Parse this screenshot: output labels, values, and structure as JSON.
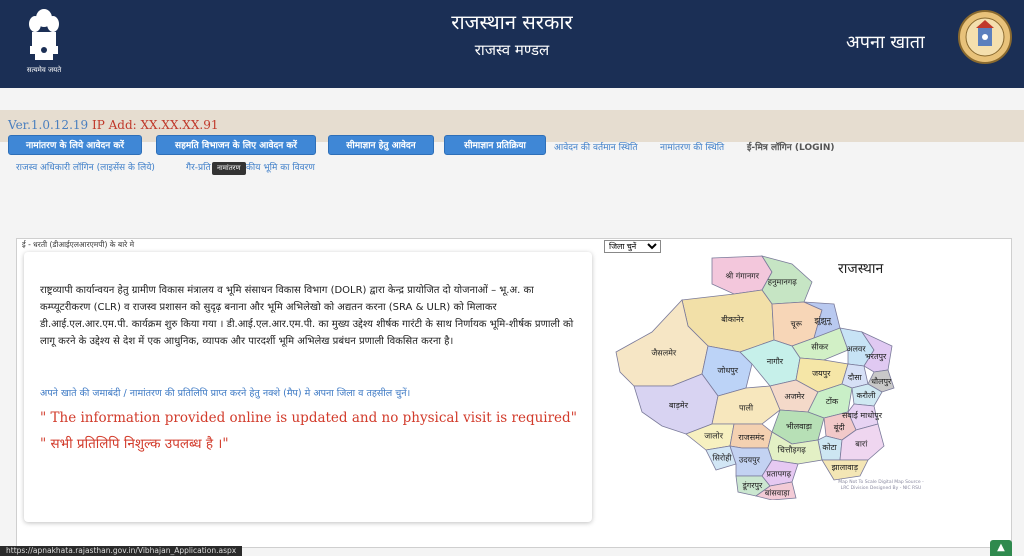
{
  "header": {
    "emblem_caption": "सत्यमेव जयते",
    "title": "राजस्थान सरकार",
    "subtitle": "राजस्व मण्डल",
    "right_title": "अपना खाता",
    "colors": {
      "header_bg": "#1b2f55",
      "nav_button": "#3f87d6",
      "link": "#3f7fc9",
      "notice_red": "#d23b2b"
    }
  },
  "version": {
    "label": "Ver.1.0.12.19",
    "ip": "IP Add: XX.XX.XX.91"
  },
  "nav": {
    "buttons": [
      "नामांतरण के लिये आवेदन करें",
      "सहमति विभाजन के लिए आवेदन करें",
      "सीमाज्ञान हेतु आवेदन",
      "सीमाज्ञान प्रतिक्रिया"
    ],
    "links": [
      "आवेदन की वर्तमान स्थिति",
      "नामांतरण की स्थिति",
      "ई-मित्र लॉगिन (LOGIN)",
      "राजस्व अधिकारी लॉगिन (लाइसेंस के लिये)",
      "गैर-प्रति",
      "कीय भूमि का विवरण"
    ],
    "tooltip": "नामांतरण"
  },
  "panel": {
    "heading": "ई - धरती (डीआईएलआरएमपी) के बारे मे",
    "paragraph": "राष्ट्रव्यापी कार्यान्वयन हेतु ग्रामीण विकास मंत्रालय व भूमि संसाधन विकास विभाग (DOLR) द्वारा केन्द्र प्रायोजित दो योजनाओं – भू.अ. का कम्प्यूटरीकरण (CLR) व राजस्व प्रशासन को सुदृढ़ बनाना और भूमि अभिलेखो को अद्यतन करना (SRA & ULR) को मिलाकर डी.आई.एल.आर.एम.पी. कार्यक्रम शुरु किया गया । डी.आई.एल.आर.एम.पी. का मुख्य उद्देश्य शीर्षक गारंटी के साथ निर्णायक भूमि-शीर्षक प्रणाली को लागू करने के उद्देश्य से देश में एक आधुनिक, व्यापक और पारदर्शी भूमि अभिलेख प्रबंधन प्रणाली विकसित करना है।",
    "instruction": "अपने खाते की जमाबंदी / नामांतरण की प्रतिलिपि प्राप्त करने हेतु नक्शे (मैप) मे अपना जिला व तहसील चुनें।",
    "notice_en": "\" The information provided online is updated and no physical visit is required\"",
    "notice_hi": "\" सभी प्रतिलिपि निशुल्क उपलब्ध है ।\""
  },
  "map": {
    "select_label": "जिला चुनें",
    "title": "राजस्थान",
    "credit": "Map Not To Scale Digital Map Source - LRC Division Designed By - NIC RSU",
    "districts": [
      {
        "name": "श्री गंगानगर",
        "color": "#f3c7dc"
      },
      {
        "name": "हनुमानगढ़",
        "color": "#c6e5c4"
      },
      {
        "name": "बीकानेर",
        "color": "#f2e0a8"
      },
      {
        "name": "चूरू",
        "color": "#f7d6b7"
      },
      {
        "name": "झुंझुनू",
        "color": "#b9c9f0"
      },
      {
        "name": "सीकर",
        "color": "#d2f0c6"
      },
      {
        "name": "अलवर",
        "color": "#c7e3f5"
      },
      {
        "name": "भरतपुर",
        "color": "#e0c9f2"
      },
      {
        "name": "धौलपुर",
        "color": "#c8c8c8"
      },
      {
        "name": "जैसलमेर",
        "color": "#f6e6c5"
      },
      {
        "name": "जोधपुर",
        "color": "#bcd3f7"
      },
      {
        "name": "नागौर",
        "color": "#c6f0ea"
      },
      {
        "name": "जयपुर",
        "color": "#f5e6a7"
      },
      {
        "name": "दौसा",
        "color": "#d6e0f6"
      },
      {
        "name": "करौली",
        "color": "#cfe9f2"
      },
      {
        "name": "अजमेर",
        "color": "#f4d9c9"
      },
      {
        "name": "टोंक",
        "color": "#c9efc7"
      },
      {
        "name": "सवाई माधोपुर",
        "color": "#e7d3f3"
      },
      {
        "name": "बाड़मेर",
        "color": "#d8d3f2"
      },
      {
        "name": "पाली",
        "color": "#f7e7bd"
      },
      {
        "name": "भीलवाड़ा",
        "color": "#b7e0b6"
      },
      {
        "name": "बूंदी",
        "color": "#f2c9c9"
      },
      {
        "name": "कोटा",
        "color": "#cde6f2"
      },
      {
        "name": "बारां",
        "color": "#efd6f0"
      },
      {
        "name": "जालोर",
        "color": "#f7f0c0"
      },
      {
        "name": "सिरोही",
        "color": "#d2e6f5"
      },
      {
        "name": "राजसमंद",
        "color": "#f4d1b1"
      },
      {
        "name": "चित्तौड़गढ़",
        "color": "#e3f0c5"
      },
      {
        "name": "झालावाड़",
        "color": "#f4e6b5"
      },
      {
        "name": "उदयपुर",
        "color": "#c3d2f2"
      },
      {
        "name": "प्रतापगढ़",
        "color": "#e6c9f2"
      },
      {
        "name": "डूंगरपुर",
        "color": "#cbe7d0"
      },
      {
        "name": "बांसवाड़ा",
        "color": "#f3cbd6"
      }
    ]
  },
  "status_bar": {
    "url": "https://apnakhata.rajasthan.gov.in/Vibhajan_Application.aspx"
  },
  "scroll_top": {
    "icon": "chevron-up-icon"
  }
}
